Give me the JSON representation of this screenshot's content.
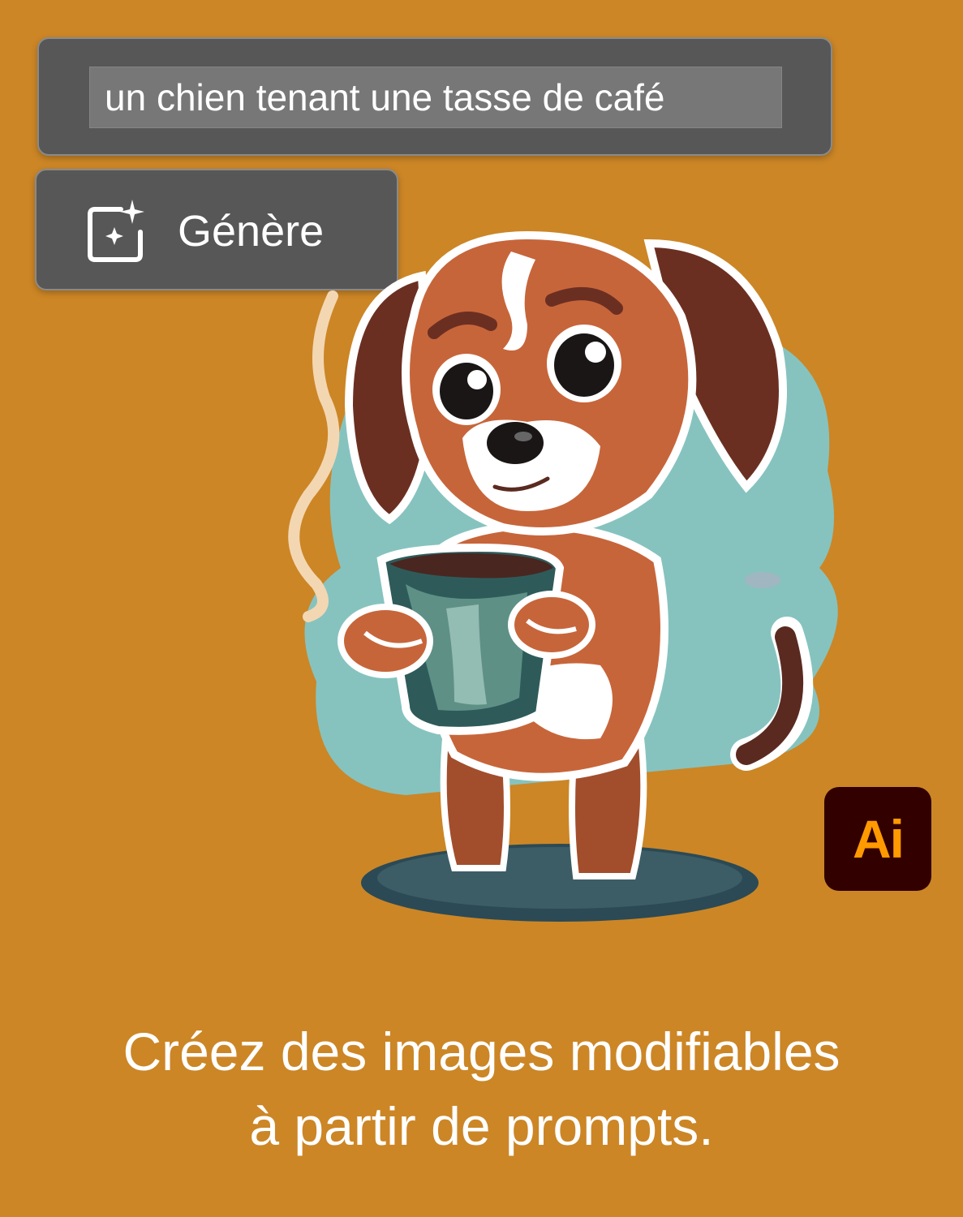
{
  "prompt": {
    "value": "un chien tenant une tasse de café"
  },
  "generate_button": {
    "label": "Génère",
    "icon": "generative-sparkle-icon"
  },
  "logo": {
    "text": "Ai",
    "icon": "adobe-illustrator-logo"
  },
  "tagline": {
    "line1": "Créez des images modifiables",
    "line2": "à partir de prompts."
  },
  "colors": {
    "background": "#cc8626",
    "panel": "#575757",
    "logo_bg": "#330000",
    "logo_text": "#ff9a00",
    "blob": "#86c3bf",
    "dog_fur": "#c7653a",
    "dog_dark": "#5a2a20",
    "cup": "#5e9086"
  }
}
